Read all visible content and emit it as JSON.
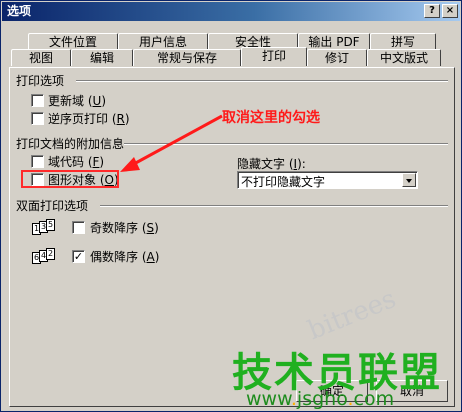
{
  "window": {
    "title": "选项",
    "help_label": "?",
    "close_label": "×"
  },
  "tabs_row1": [
    {
      "label": "文件位置"
    },
    {
      "label": "用户信息"
    },
    {
      "label": "安全性"
    },
    {
      "label": "输出 PDF"
    },
    {
      "label": "拼写"
    }
  ],
  "tabs_row2": [
    {
      "label": "视图"
    },
    {
      "label": "编辑"
    },
    {
      "label": "常规与保存"
    },
    {
      "label": "打印",
      "active": true
    },
    {
      "label": "修订"
    },
    {
      "label": "中文版式"
    }
  ],
  "print_options": {
    "title": "打印选项",
    "items": [
      {
        "label": "更新域",
        "key": "U",
        "checked": false
      },
      {
        "label": "逆序页打印",
        "key": "R",
        "checked": false
      }
    ]
  },
  "attached_info": {
    "title": "打印文档的附加信息",
    "items": [
      {
        "label": "域代码",
        "key": "F",
        "checked": false
      },
      {
        "label": "图形对象",
        "key": "O",
        "checked": false
      }
    ],
    "hidden_text": {
      "label": "隐藏文字",
      "key": "I",
      "selected": "不打印隐藏文字"
    }
  },
  "duplex": {
    "title": "双面打印选项",
    "items": [
      {
        "label": "奇数降序",
        "key": "S",
        "checked": false,
        "pages": [
          "1",
          "3",
          "5"
        ]
      },
      {
        "label": "偶数降序",
        "key": "A",
        "checked": true,
        "pages": [
          "6",
          "4",
          "2"
        ]
      }
    ]
  },
  "buttons": {
    "ok_label": "确定",
    "cancel_label": "取消"
  },
  "annotation": {
    "text": "取消这里的勾选",
    "color": "#ff1a1a"
  },
  "watermark": {
    "logo_text": "技术员联盟",
    "url_prefix": "www",
    "url_name": "jsgho",
    "url_suffix": "com",
    "stamp_text": "bitrees"
  }
}
